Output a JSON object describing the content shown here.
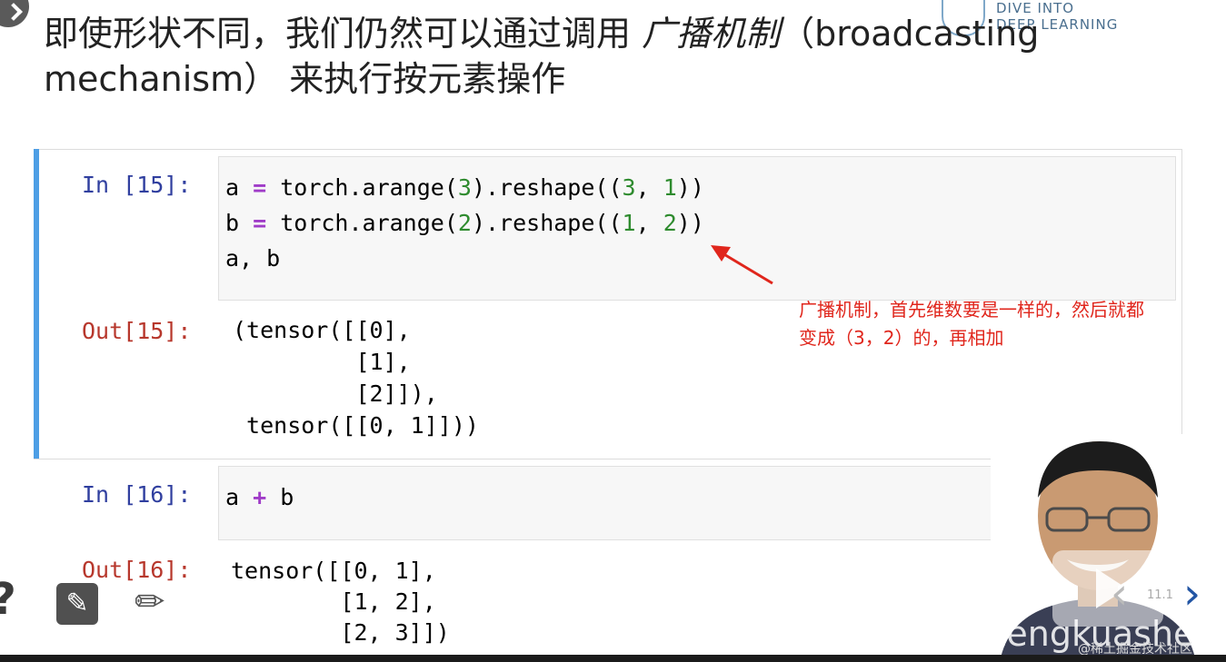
{
  "logo": {
    "line1": "DIVE INTO",
    "line2": "DEEP LEARNING"
  },
  "heading": {
    "part1": "即使形状不同，我们仍然可以通过调用 ",
    "emph": "广播机制",
    "part2": "（broadcasting mechanism） 来执行按元素操作"
  },
  "cells": {
    "in15": {
      "prompt": "In [15]:",
      "line1": {
        "t1": "a ",
        "op": "=",
        "t2": " torch.arange(",
        "n1": "3",
        "t3": ").reshape((",
        "n2": "3",
        "t4": ", ",
        "n3": "1",
        "t5": "))"
      },
      "line2": {
        "t1": "b ",
        "op": "=",
        "t2": " torch.arange(",
        "n1": "2",
        "t3": ").reshape((",
        "n2": "1",
        "t4": ", ",
        "n3": "2",
        "t5": "))"
      },
      "line3": "a, b"
    },
    "out15": {
      "prompt": "Out[15]:",
      "lines": [
        "(tensor([[0],",
        "         [1],",
        "         [2]]),",
        " tensor([[0, 1]]))"
      ]
    },
    "in16": {
      "prompt": "In [16]:",
      "t1": "a ",
      "op": "+",
      "t2": " b"
    },
    "out16": {
      "prompt": "Out[16]:",
      "lines": [
        "tensor([[0, 1],",
        "        [1, 2],",
        "        [2, 3]])"
      ]
    }
  },
  "annotation": {
    "line1": "广播机制，首先维数要是一样的，然后就都",
    "line2": "变成（3，2）的，再相加",
    "color": "#e0261c"
  },
  "slide": {
    "number": "11.1"
  },
  "overlay": {
    "watermark": "aqzengkuashen",
    "credit": "@稀土掘金技术社区"
  },
  "icons": [
    "arrow-icon",
    "help-icon",
    "edit-icon",
    "pencil-icon",
    "play-icon",
    "chevron-left-icon",
    "chevron-right-icon"
  ]
}
